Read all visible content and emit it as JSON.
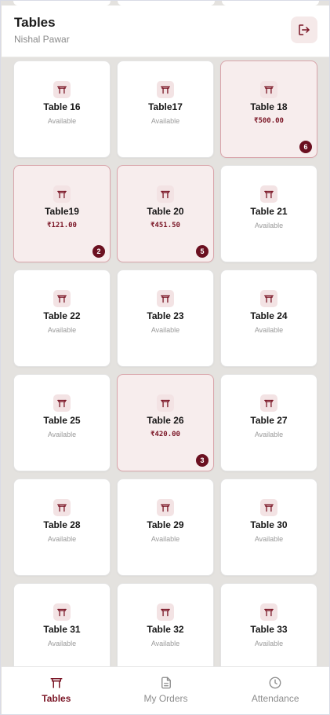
{
  "header": {
    "title": "Tables",
    "subtitle": "Nishal Pawar",
    "logout_icon": "logout-icon"
  },
  "colors": {
    "accent": "#7a1525",
    "badge": "#6b1020",
    "occupied_bg": "#f7eded",
    "occupied_border": "#d9a5ab",
    "page_bg": "#e4e2df"
  },
  "tables": [
    {
      "name": "Table 16",
      "status": "Available",
      "occupied": false
    },
    {
      "name": "Table17",
      "status": "Available",
      "occupied": false
    },
    {
      "name": "Table 18",
      "amount": "₹500.00",
      "occupied": true,
      "guests": "6"
    },
    {
      "name": "Table19",
      "amount": "₹121.00",
      "occupied": true,
      "guests": "2"
    },
    {
      "name": "Table 20",
      "amount": "₹451.50",
      "occupied": true,
      "guests": "5"
    },
    {
      "name": "Table 21",
      "status": "Available",
      "occupied": false
    },
    {
      "name": "Table 22",
      "status": "Available",
      "occupied": false
    },
    {
      "name": "Table 23",
      "status": "Available",
      "occupied": false
    },
    {
      "name": "Table 24",
      "status": "Available",
      "occupied": false
    },
    {
      "name": "Table 25",
      "status": "Available",
      "occupied": false
    },
    {
      "name": "Table 26",
      "amount": "₹420.00",
      "occupied": true,
      "guests": "3"
    },
    {
      "name": "Table 27",
      "status": "Available",
      "occupied": false
    },
    {
      "name": "Table 28",
      "status": "Available",
      "occupied": false
    },
    {
      "name": "Table 29",
      "status": "Available",
      "occupied": false
    },
    {
      "name": "Table 30",
      "status": "Available",
      "occupied": false
    },
    {
      "name": "Table 31",
      "status": "Available",
      "occupied": false
    },
    {
      "name": "Table 32",
      "status": "Available",
      "occupied": false
    },
    {
      "name": "Table 33",
      "status": "Available",
      "occupied": false
    }
  ],
  "bottom_nav": {
    "items": [
      {
        "label": "Tables",
        "icon": "table-icon",
        "active": true
      },
      {
        "label": "My Orders",
        "icon": "document-icon",
        "active": false
      },
      {
        "label": "Attendance",
        "icon": "clock-icon",
        "active": false
      }
    ]
  }
}
